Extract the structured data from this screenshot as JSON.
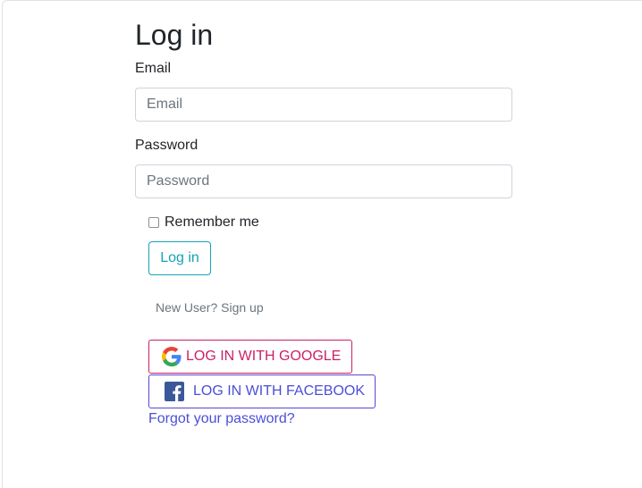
{
  "page": {
    "title": "Log in"
  },
  "form": {
    "email_label": "Email",
    "email_placeholder": "Email",
    "email_value": "",
    "password_label": "Password",
    "password_placeholder": "Password",
    "password_value": "",
    "remember_label": "Remember me",
    "remember_checked": false,
    "login_button": "Log in",
    "signup_link": "New User? Sign up"
  },
  "social": {
    "google_label": "LOG IN WITH GOOGLE",
    "google_icon": "google-icon",
    "facebook_label": "LOG IN WITH FACEBOOK",
    "facebook_icon": "facebook-icon"
  },
  "links": {
    "forgot_password": "Forgot your password?"
  },
  "colors": {
    "login_button": "#17a2b8",
    "google_button": "#cc1f64",
    "facebook_button": "#4b4fd6",
    "link": "#4b4fd6",
    "facebook_brand": "#3b5998"
  }
}
